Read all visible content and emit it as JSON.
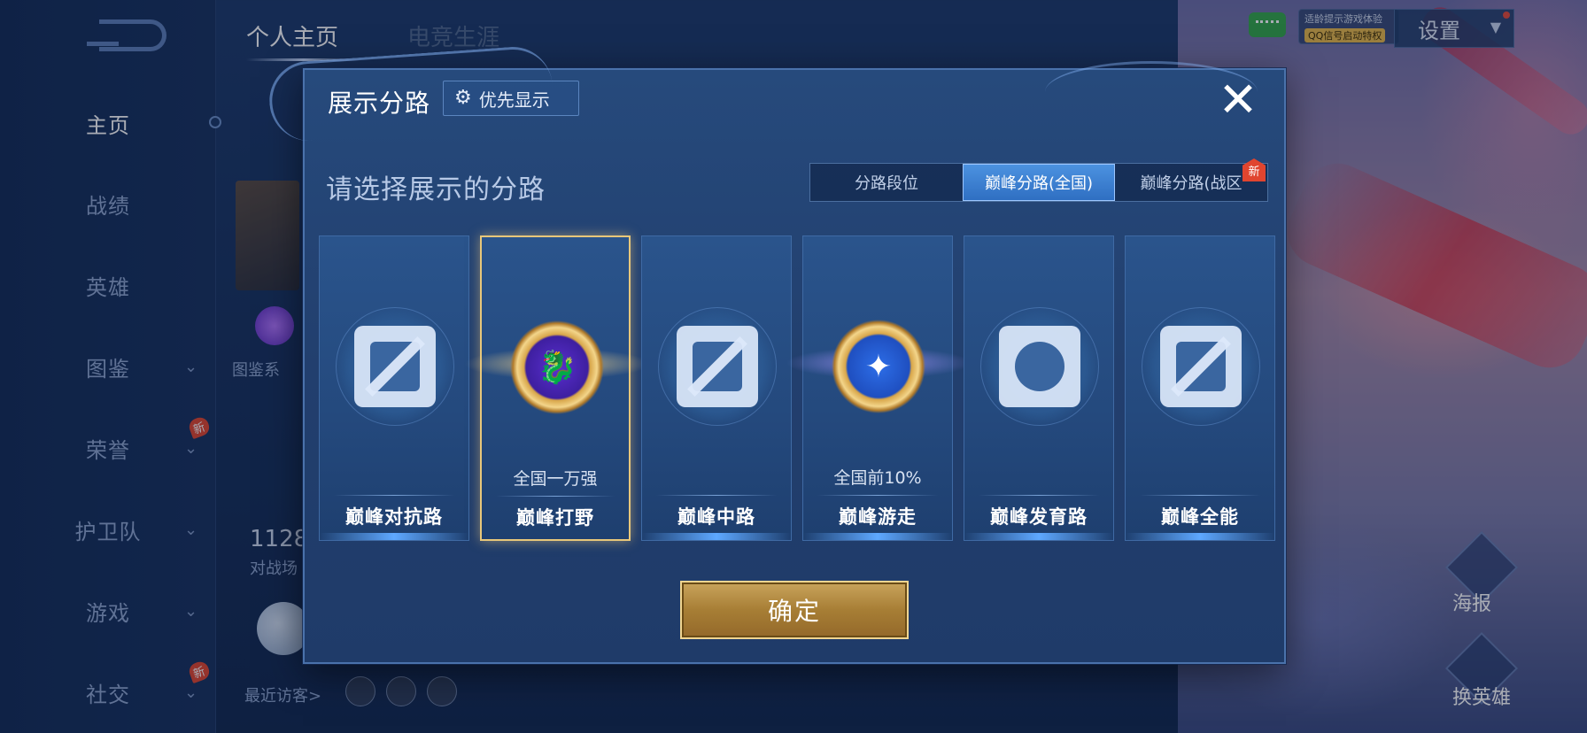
{
  "sidebar": {
    "items": [
      {
        "label": "主页",
        "active": true
      },
      {
        "label": "战绩"
      },
      {
        "label": "英雄"
      },
      {
        "label": "图鉴",
        "chevron": true
      },
      {
        "label": "荣誉",
        "chevron": true,
        "badge": "新"
      },
      {
        "label": "护卫队",
        "chevron": true
      },
      {
        "label": "游戏",
        "chevron": true
      },
      {
        "label": "社交",
        "chevron": true,
        "badge": "新"
      }
    ]
  },
  "header": {
    "tabs": [
      {
        "label": "个人主页",
        "active": true
      },
      {
        "label": "电竞生涯",
        "active": false
      }
    ],
    "promo_line1": "适龄提示游戏体验",
    "promo_line2": "QQ信号启动特权",
    "settings_label": "设置"
  },
  "background": {
    "gallery_label": "图鉴系",
    "stat_number": "1128",
    "stat_label": "对战场",
    "recent_visitors_label": "最近访客>",
    "poster_label": "海报",
    "switch_hero_label": "换英雄"
  },
  "modal": {
    "title": "展示分路",
    "priority_label": "优先显示",
    "close_label": "✕",
    "subtitle": "请选择展示的分路",
    "segments": [
      {
        "label": "分路段位",
        "selected": false
      },
      {
        "label": "巅峰分路(全国)",
        "selected": true
      },
      {
        "label": "巅峰分路(战区",
        "selected": false,
        "badge": "新"
      }
    ],
    "cards": [
      {
        "label": "巅峰对抗路",
        "rank": "",
        "icon": "clash-lane-icon",
        "selected": false
      },
      {
        "label": "巅峰打野",
        "rank": "全国一万强",
        "icon": "jungle-medal-icon",
        "selected": true
      },
      {
        "label": "巅峰中路",
        "rank": "",
        "icon": "mid-lane-icon",
        "selected": false
      },
      {
        "label": "巅峰游走",
        "rank": "全国前10%",
        "icon": "roam-medal-icon",
        "selected": false
      },
      {
        "label": "巅峰发育路",
        "rank": "",
        "icon": "farm-lane-icon",
        "selected": false
      },
      {
        "label": "巅峰全能",
        "rank": "",
        "icon": "all-round-icon",
        "selected": false
      }
    ],
    "confirm_label": "确定"
  },
  "colors": {
    "accent_gold": "#e8c77a",
    "selected_tab": "#3a80d4",
    "new_badge": "#e0452f"
  }
}
